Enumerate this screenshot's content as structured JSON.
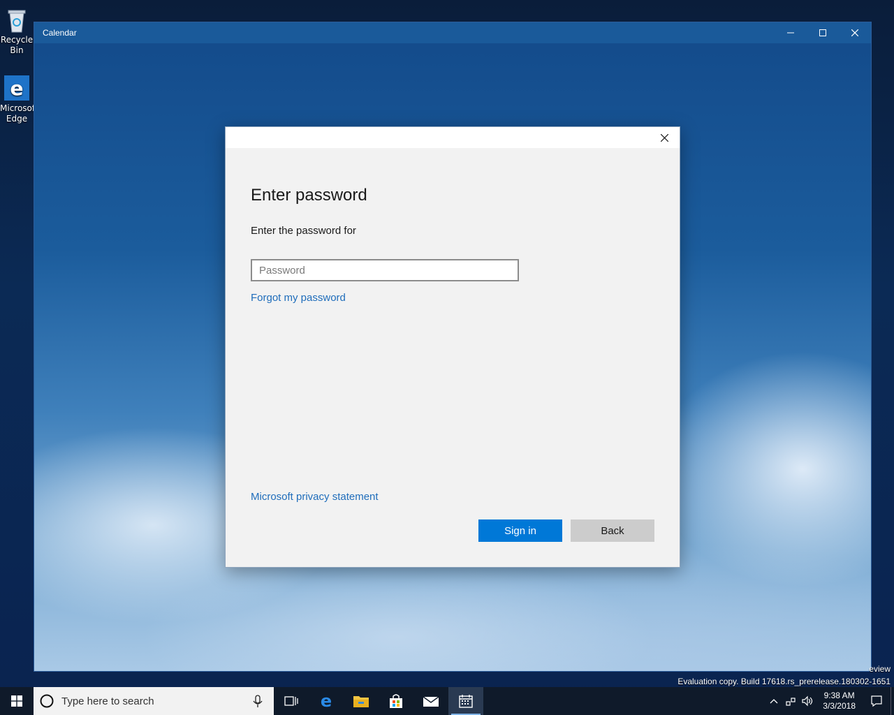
{
  "desktop": {
    "icons": [
      {
        "label": "Recycle Bin"
      },
      {
        "label": "Microsoft Edge"
      }
    ]
  },
  "window": {
    "title": "Calendar"
  },
  "dialog": {
    "heading": "Enter password",
    "subtext": "Enter the password for",
    "password_placeholder": "Password",
    "forgot_link": "Forgot my password",
    "privacy_link": "Microsoft privacy statement",
    "signin_label": "Sign in",
    "back_label": "Back"
  },
  "watermark": {
    "line1": "eview",
    "line2": "Evaluation copy. Build 17618.rs_prerelease.180302-1651"
  },
  "taskbar": {
    "search_placeholder": "Type here to search",
    "clock_time": "9:38 AM",
    "clock_date": "3/3/2018"
  },
  "colors": {
    "accent": "#0078d7",
    "link": "#1f6dbb",
    "titlebar": "#1a5a9a"
  }
}
